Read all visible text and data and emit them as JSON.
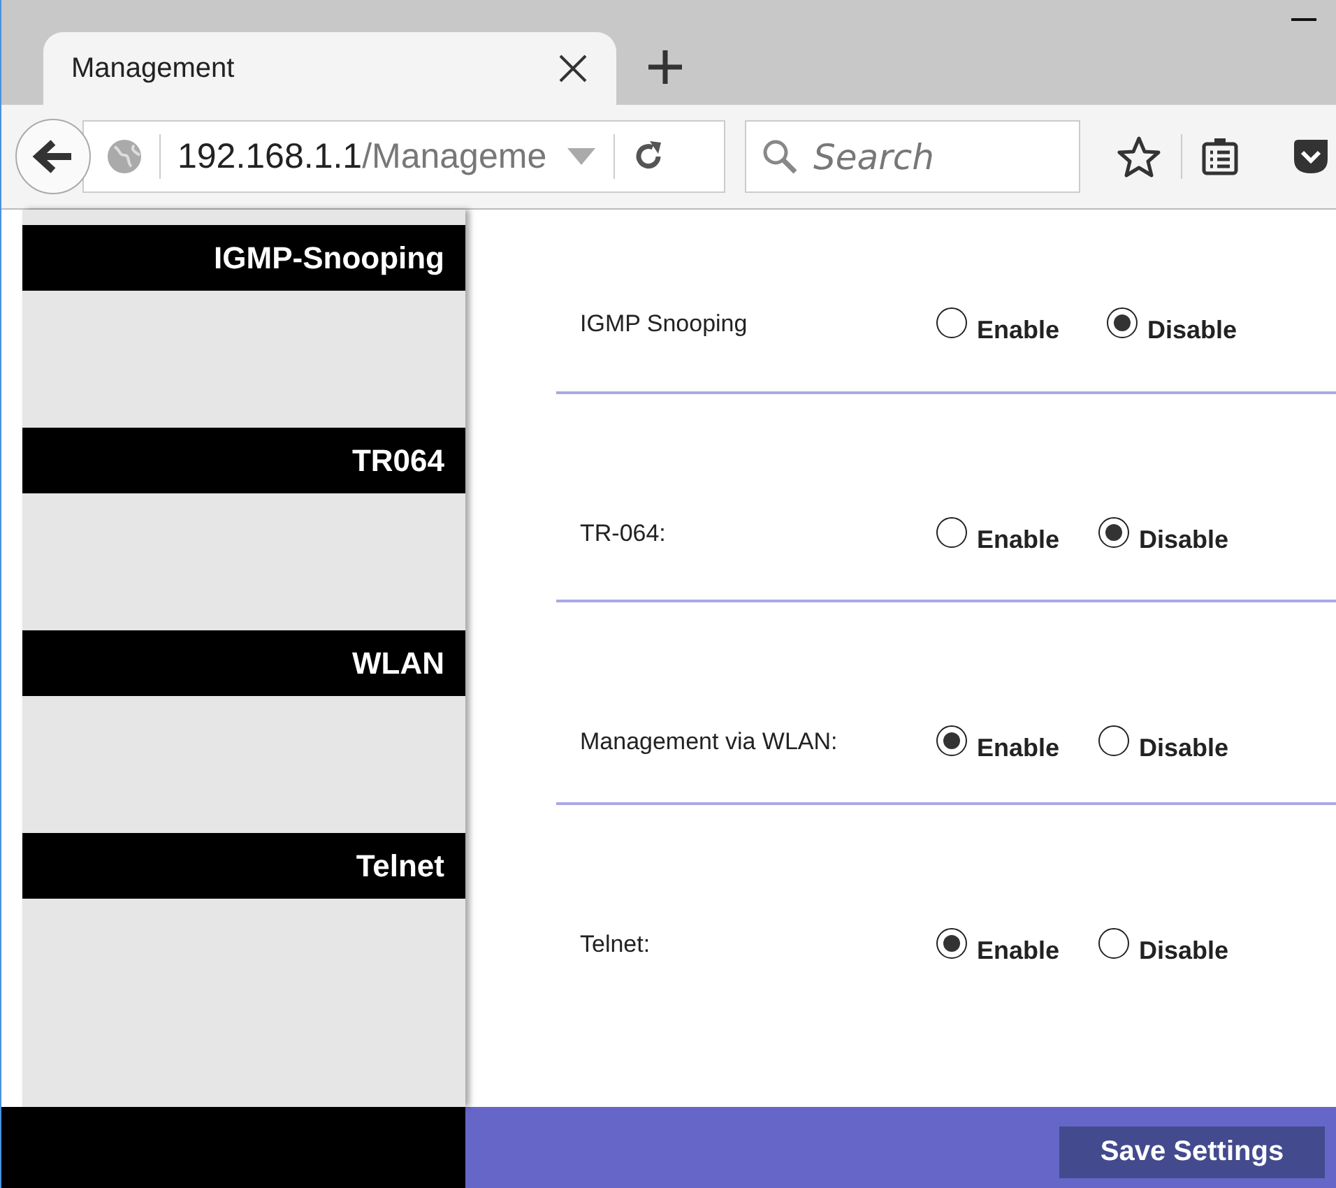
{
  "browser": {
    "tab_title": "Management",
    "url_host": "192.168.1.1",
    "url_path": "/Manageme",
    "search": {
      "placeholder": "Search"
    }
  },
  "sidebar": {
    "sections": [
      {
        "title": "IGMP-Snooping"
      },
      {
        "title": "TR064"
      },
      {
        "title": "WLAN"
      },
      {
        "title": "Telnet"
      }
    ]
  },
  "settings": [
    {
      "label": "IGMP Snooping",
      "options": [
        {
          "label": "Enable",
          "selected": false
        },
        {
          "label": "Disable",
          "selected": true
        }
      ]
    },
    {
      "label": "TR-064:",
      "options": [
        {
          "label": "Enable",
          "selected": false
        },
        {
          "label": "Disable",
          "selected": true
        }
      ]
    },
    {
      "label": "Management via WLAN:",
      "options": [
        {
          "label": "Enable",
          "selected": true
        },
        {
          "label": "Disable",
          "selected": false
        }
      ]
    },
    {
      "label": "Telnet:",
      "options": [
        {
          "label": "Enable",
          "selected": true
        },
        {
          "label": "Disable",
          "selected": false
        }
      ]
    }
  ],
  "footer": {
    "button": "Save Settings"
  }
}
